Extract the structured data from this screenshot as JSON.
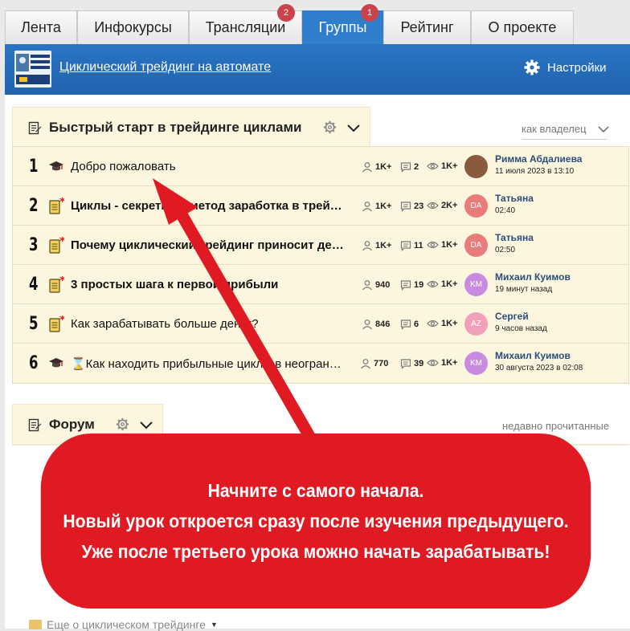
{
  "tabs": [
    {
      "label": "Лента",
      "badge": "",
      "active": false
    },
    {
      "label": "Инфокурсы",
      "badge": "",
      "active": false
    },
    {
      "label": "Трансляции",
      "badge": "2",
      "active": false
    },
    {
      "label": "Группы",
      "badge": "1",
      "active": true
    },
    {
      "label": "Рейтинг",
      "badge": "",
      "active": false
    },
    {
      "label": "О проекте",
      "badge": "",
      "active": false
    }
  ],
  "header": {
    "title": "Циклический трейдинг на автомате",
    "settings_label": "Настройки"
  },
  "section1": {
    "title": "Быстрый старт в трейдинге циклами",
    "sort_label": "как владелец"
  },
  "rows": [
    {
      "num": "1",
      "icon": "graduation-cap-icon",
      "title": "Добро пожаловать",
      "bold": false,
      "members": "1K+",
      "comments": "2",
      "views": "1K+",
      "avatar_text": "",
      "avatar_color": "#8a5a3c",
      "user": "Римма Абдалиева",
      "date": "11 июля 2023 в 13:10"
    },
    {
      "num": "2",
      "icon": "new-notes-icon",
      "title": "Циклы - секретный метод заработка в трейдинге",
      "bold": true,
      "members": "1K+",
      "comments": "23",
      "views": "2K+",
      "avatar_text": "DA",
      "avatar_color": "#e97b7b",
      "user": "Татьяна",
      "date": "02:40"
    },
    {
      "num": "3",
      "icon": "new-notes-icon",
      "title": "Почему циклический трейдинг приносит деньги",
      "bold": true,
      "members": "1K+",
      "comments": "11",
      "views": "1K+",
      "avatar_text": "DA",
      "avatar_color": "#e97b7b",
      "user": "Татьяна",
      "date": "02:50"
    },
    {
      "num": "4",
      "icon": "new-notes-icon",
      "title": "3 простых шага к первой прибыли",
      "bold": true,
      "members": "940",
      "comments": "19",
      "views": "1K+",
      "avatar_text": "KM",
      "avatar_color": "#c88be0",
      "user": "Михаил Куимов",
      "date": "19 минут назад"
    },
    {
      "num": "5",
      "icon": "new-notes-icon",
      "title": "Как зарабатывать больше денег?",
      "bold": false,
      "members": "846",
      "comments": "6",
      "views": "1K+",
      "avatar_text": "AZ",
      "avatar_color": "#f1a0b8",
      "user": "Сергей",
      "date": "9 часов назад"
    },
    {
      "num": "6",
      "icon": "graduation-cap-icon",
      "title": "⌛Как находить прибыльные циклы в неограниченном количестве",
      "bold": false,
      "members": "770",
      "comments": "39",
      "views": "1K+",
      "avatar_text": "KM",
      "avatar_color": "#c88be0",
      "user": "Михаил Куимов",
      "date": "30 августа 2023 в 02:08"
    }
  ],
  "section2": {
    "title": "Форум",
    "sort_label": "недавно прочитанные"
  },
  "callout": {
    "line1": "Начните с самого начала.",
    "line2": "Новый урок откроется сразу после изучения предыдущего.",
    "line3": "Уже после третьего урока можно начать зарабатывать!"
  },
  "bottom_item": "Еще о циклическом трейдинге",
  "colors": {
    "accent": "#2f7ecb",
    "callout": "#e01a22",
    "row_bg": "#fdf6df",
    "badge": "#c8434b"
  }
}
